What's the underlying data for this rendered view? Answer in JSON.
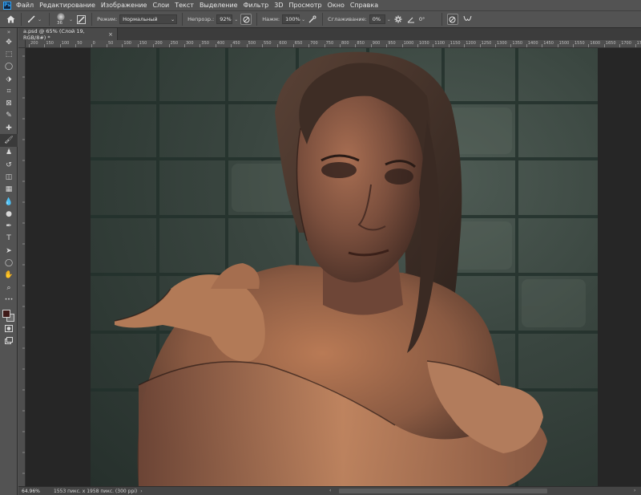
{
  "app": {
    "logo": "Ps"
  },
  "menu": [
    "Файл",
    "Редактирование",
    "Изображение",
    "Слои",
    "Текст",
    "Выделение",
    "Фильтр",
    "3D",
    "Просмотр",
    "Окно",
    "Справка"
  ],
  "options": {
    "brush_size": "36",
    "mode_label": "Режим:",
    "mode_value": "Нормальный",
    "opacity_label": "Непрозр.:",
    "opacity_value": "92%",
    "flow_label": "Нажм:",
    "flow_value": "100%",
    "smoothing_label": "Сглаживание:",
    "smoothing_value": "0%",
    "angle_value": "0°"
  },
  "document": {
    "tab_title": "a.psd @ 65% (Слой 19, RGB/8#) *",
    "close_glyph": "×"
  },
  "ruler": {
    "top_ticks": [
      "200",
      "150",
      "100",
      "50",
      "0",
      "50",
      "100",
      "150",
      "200",
      "250",
      "300",
      "350",
      "400",
      "450",
      "500",
      "550",
      "600",
      "650",
      "700",
      "750",
      "800",
      "850",
      "900",
      "950",
      "1000",
      "1050",
      "1100",
      "1150",
      "1200",
      "1250",
      "1300",
      "1350",
      "1400",
      "1450",
      "1500",
      "1550",
      "1600",
      "1650",
      "1700",
      "1750"
    ]
  },
  "status": {
    "zoom": "64.96%",
    "doc_info": "1553 пикс. x 1958 пикс. (300 ppi)"
  },
  "tools": [
    {
      "name": "move-tool",
      "glyph": "✥"
    },
    {
      "name": "marquee-tool",
      "glyph": "⬚"
    },
    {
      "name": "lasso-tool",
      "glyph": "◯"
    },
    {
      "name": "object-select-tool",
      "glyph": "⬗"
    },
    {
      "name": "crop-tool",
      "glyph": "⌗"
    },
    {
      "name": "frame-tool",
      "glyph": "⊠"
    },
    {
      "name": "eyedropper-tool",
      "glyph": "✎"
    },
    {
      "name": "healing-tool",
      "glyph": "✚"
    },
    {
      "name": "brush-tool",
      "glyph": "🖌"
    },
    {
      "name": "stamp-tool",
      "glyph": "♟"
    },
    {
      "name": "history-brush-tool",
      "glyph": "↺"
    },
    {
      "name": "eraser-tool",
      "glyph": "◫"
    },
    {
      "name": "gradient-tool",
      "glyph": "▦"
    },
    {
      "name": "blur-tool",
      "glyph": "💧"
    },
    {
      "name": "dodge-tool",
      "glyph": "●"
    },
    {
      "name": "pen-tool",
      "glyph": "✒"
    },
    {
      "name": "type-tool",
      "glyph": "T"
    },
    {
      "name": "path-select-tool",
      "glyph": "➤"
    },
    {
      "name": "shape-tool",
      "glyph": "◯"
    },
    {
      "name": "hand-tool",
      "glyph": "✋"
    },
    {
      "name": "zoom-tool",
      "glyph": "⌕"
    },
    {
      "name": "more-tools",
      "glyph": "•••"
    }
  ],
  "colors": {
    "foreground": "#3f1a18",
    "background": "#6e6e6e"
  }
}
